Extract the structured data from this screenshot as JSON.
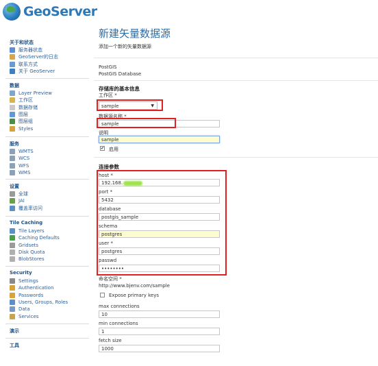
{
  "app": {
    "logo_text": "GeoServer"
  },
  "sidebar": {
    "sections": [
      {
        "title": "关于和状态",
        "items": [
          {
            "label": "服务器状态",
            "icon": "server-status-icon",
            "color": "#5b8fd6"
          },
          {
            "label": "GeoServer的日志",
            "icon": "log-icon",
            "color": "#d4a84a"
          },
          {
            "label": "联系方式",
            "icon": "contact-icon",
            "color": "#6a9bd0"
          },
          {
            "label": "关于 GeoServer",
            "icon": "about-icon",
            "color": "#3b7fc4"
          }
        ]
      },
      {
        "title": "数据",
        "items": [
          {
            "label": "Layer Preview",
            "icon": "layer-preview-icon",
            "color": "#7fa5c8"
          },
          {
            "label": "工作区",
            "icon": "workspace-icon",
            "color": "#d8b44c"
          },
          {
            "label": "数据存储",
            "icon": "store-icon",
            "color": "#c9c9c9"
          },
          {
            "label": "图层",
            "icon": "layers-icon",
            "color": "#5f9ad6"
          },
          {
            "label": "图层组",
            "icon": "layergroup-icon",
            "color": "#4a8c4a"
          },
          {
            "label": "Styles",
            "icon": "styles-icon",
            "color": "#d6a43a"
          }
        ]
      },
      {
        "title": "服务",
        "items": [
          {
            "label": "WMTS",
            "icon": "wmts-icon",
            "color": "#8aa1b8"
          },
          {
            "label": "WCS",
            "icon": "wcs-icon",
            "color": "#8aa1b8"
          },
          {
            "label": "WFS",
            "icon": "wfs-icon",
            "color": "#8aa1b8"
          },
          {
            "label": "WMS",
            "icon": "wms-icon",
            "color": "#8aa1b8"
          }
        ]
      },
      {
        "title": "设置",
        "items": [
          {
            "label": "全球",
            "icon": "global-icon",
            "color": "#9a9a9a"
          },
          {
            "label": "JAI",
            "icon": "jai-icon",
            "color": "#6aa04a"
          },
          {
            "label": "覆盖率访问",
            "icon": "coverage-icon",
            "color": "#5a8fc8"
          }
        ]
      },
      {
        "title": "Tile Caching",
        "items": [
          {
            "label": "Tile Layers",
            "icon": "tile-layers-icon",
            "color": "#5a8fc8"
          },
          {
            "label": "Caching Defaults",
            "icon": "caching-defaults-icon",
            "color": "#4aa04a"
          },
          {
            "label": "Gridsets",
            "icon": "gridsets-icon",
            "color": "#9a9a9a"
          },
          {
            "label": "Disk Quota",
            "icon": "disk-quota-icon",
            "color": "#b0b0b0"
          },
          {
            "label": "BlobStores",
            "icon": "blobstores-icon",
            "color": "#b0b0b0"
          }
        ]
      },
      {
        "title": "Security",
        "items": [
          {
            "label": "Settings",
            "icon": "settings-icon",
            "color": "#8a8a8a"
          },
          {
            "label": "Authentication",
            "icon": "authentication-icon",
            "color": "#d6a43a"
          },
          {
            "label": "Passwords",
            "icon": "passwords-icon",
            "color": "#d6a43a"
          },
          {
            "label": "Users, Groups, Roles",
            "icon": "users-icon",
            "color": "#5a8fc8"
          },
          {
            "label": "Data",
            "icon": "data-security-icon",
            "color": "#7a9ac0"
          },
          {
            "label": "Services",
            "icon": "services-security-icon",
            "color": "#c9a24a"
          }
        ]
      },
      {
        "title": "演示",
        "items": []
      },
      {
        "title": "工具",
        "items": []
      }
    ]
  },
  "main": {
    "title": "新建矢量数据源",
    "subtitle": "添加一个新的矢量数据源",
    "store_type": "PostGIS",
    "store_desc": "PostGIS Database",
    "basic_section": "存储库的基本信息",
    "workspace_label": "工作区 *",
    "workspace_value": "sample",
    "store_name_label": "数据源名称 *",
    "store_name_value": "sample",
    "desc_label": "说明",
    "desc_value": "sample",
    "enabled_label": "启用",
    "conn_section": "连接参数",
    "host_label": "host *",
    "host_value": "192.168.",
    "port_label": "port *",
    "port_value": "5432",
    "database_label": "database",
    "database_value": "postgis_sample",
    "schema_label": "schema",
    "schema_value": "postgres",
    "user_label": "user *",
    "user_value": "postgres",
    "passwd_label": "passwd",
    "passwd_value": "••••••••",
    "namespace_label": "命名空间 *",
    "namespace_value": "http://www.bjenv.com/sample",
    "expose_pk_label": "Expose primary keys",
    "max_conn_label": "max connections",
    "max_conn_value": "10",
    "min_conn_label": "min connections",
    "min_conn_value": "1",
    "fetch_size_label": "fetch size",
    "fetch_size_value": "1000"
  },
  "colors": {
    "accent": "#2e6da4",
    "highlight": "#e02020",
    "autofill": "#fdfbd0"
  }
}
